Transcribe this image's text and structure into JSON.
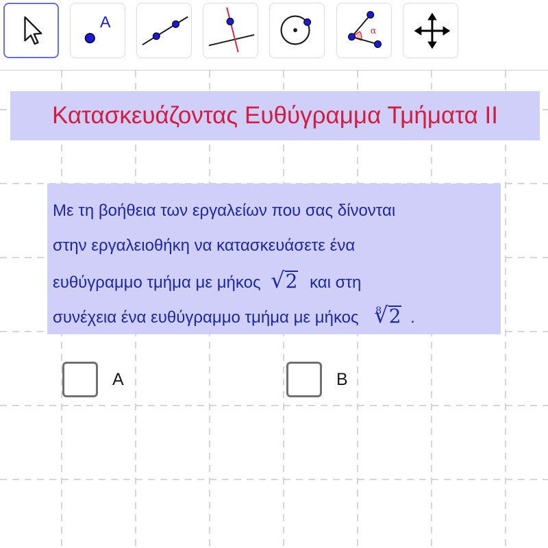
{
  "toolbar": {
    "tools": [
      {
        "name": "move-tool",
        "icon": "cursor-arrow-icon",
        "selected": true
      },
      {
        "name": "point-tool",
        "icon": "point-icon",
        "label": "A"
      },
      {
        "name": "line-tool",
        "icon": "line-through-two-points-icon"
      },
      {
        "name": "perpendicular-line-tool",
        "icon": "perpendicular-line-icon"
      },
      {
        "name": "circle-tool",
        "icon": "circle-center-point-icon"
      },
      {
        "name": "angle-tool",
        "icon": "angle-icon",
        "label": "α"
      },
      {
        "name": "move-graphics-view-tool",
        "icon": "four-way-arrows-icon"
      }
    ]
  },
  "title": "Κατασκευάζοντας Ευθύγραμμα Τμήματα ΙΙ",
  "instructions": {
    "line1": "Με τη βοήθεια των εργαλείων που σας δίνονται",
    "line2": "στην εργαλειοθήκη να κατασκευάσετε ένα",
    "line3_prefix": "ευθύγραμμο τμήμα με μήκος",
    "math1": {
      "radical": "√",
      "radicand": "2"
    },
    "line3_suffix": "και στη",
    "line4_prefix": "συνέχεια ένα ευθύγραμμο τμήμα με μήκος",
    "math2": {
      "index": "8",
      "radical": "√",
      "radicand": "2"
    },
    "line4_suffix": "."
  },
  "checkboxes": [
    {
      "label": "A",
      "checked": false
    },
    {
      "label": "B",
      "checked": false
    }
  ],
  "colors": {
    "accent": "#6b6ee0",
    "title_text": "#d21c42",
    "box_background": "#cfcff9",
    "body_text": "#1e27a8",
    "point": "#1a1adc",
    "grid": "#c8c8c8"
  }
}
